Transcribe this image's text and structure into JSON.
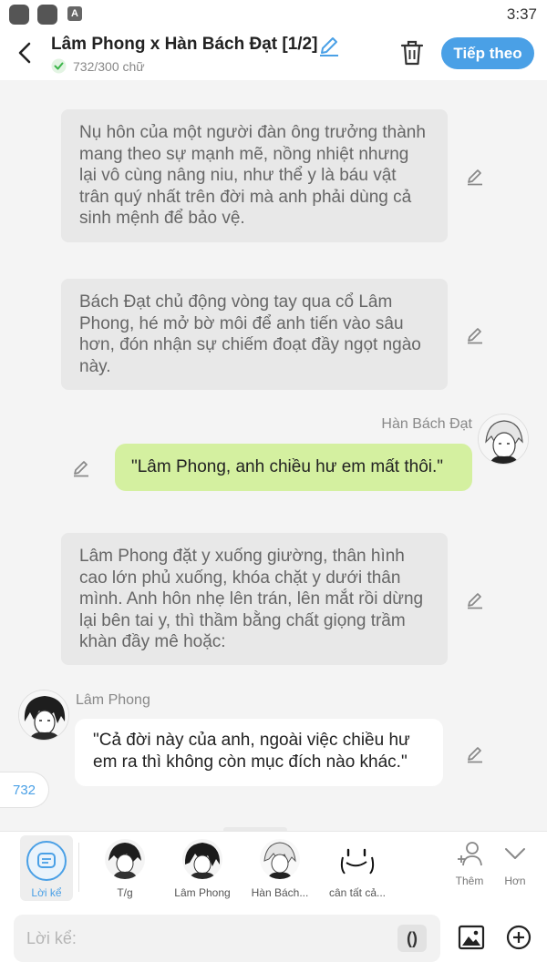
{
  "status_bar": {
    "time": "3:37",
    "app_badge": "A"
  },
  "header": {
    "title": "Lâm Phong x Hàn Bách Đạt [1/2]",
    "word_count": "732/300 chữ",
    "next_label": "Tiếp theo"
  },
  "messages": {
    "narration_1": "Nụ hôn của một người đàn ông trưởng thành mang theo sự mạnh mẽ, nồng nhiệt nhưng lại vô cùng nâng niu, như thể y là báu vật trân quý nhất trên đời mà anh phải dùng cả sinh mệnh để bảo vệ.",
    "narration_2": "Bách Đạt chủ động vòng tay qua cổ Lâm Phong, hé mở bờ môi để anh tiến vào sâu hơn, đón nhận sự chiếm đoạt đầy ngọt ngào này.",
    "speaker_right": "Hàn Bách Đạt",
    "dialogue_right": "\"Lâm Phong, anh chiều hư em mất thôi.\"",
    "narration_3": "Lâm Phong đặt y xuống giường, thân hình cao lớn phủ xuống, khóa chặt y dưới thân mình. Anh hôn nhẹ lên trán, lên mắt rồi dừng lại bên tai y, thì thầm bằng chất giọng trầm khàn đầy mê hoặc:",
    "speaker_left": "Lâm Phong",
    "dialogue_left": "\"Cả đời này của anh, ngoài việc chiều hư em ra thì không còn mục đích nào khác.\""
  },
  "count_pill": "732",
  "characters": [
    {
      "label": "Lời kể"
    },
    {
      "label": "T/g"
    },
    {
      "label": "Lâm Phong"
    },
    {
      "label": "Hàn Bách..."
    },
    {
      "label": "cân tất cả..."
    }
  ],
  "tools": {
    "add_label": "Thêm",
    "more_label": "Hơn"
  },
  "input": {
    "placeholder": "Lời kể:",
    "paren_label": "()"
  },
  "colors": {
    "accent": "#4aa0e6",
    "narration_bg": "#e8e8e8",
    "right_bubble": "#d4f0a0",
    "left_bubble": "#ffffff",
    "background": "#f4f4f4"
  }
}
